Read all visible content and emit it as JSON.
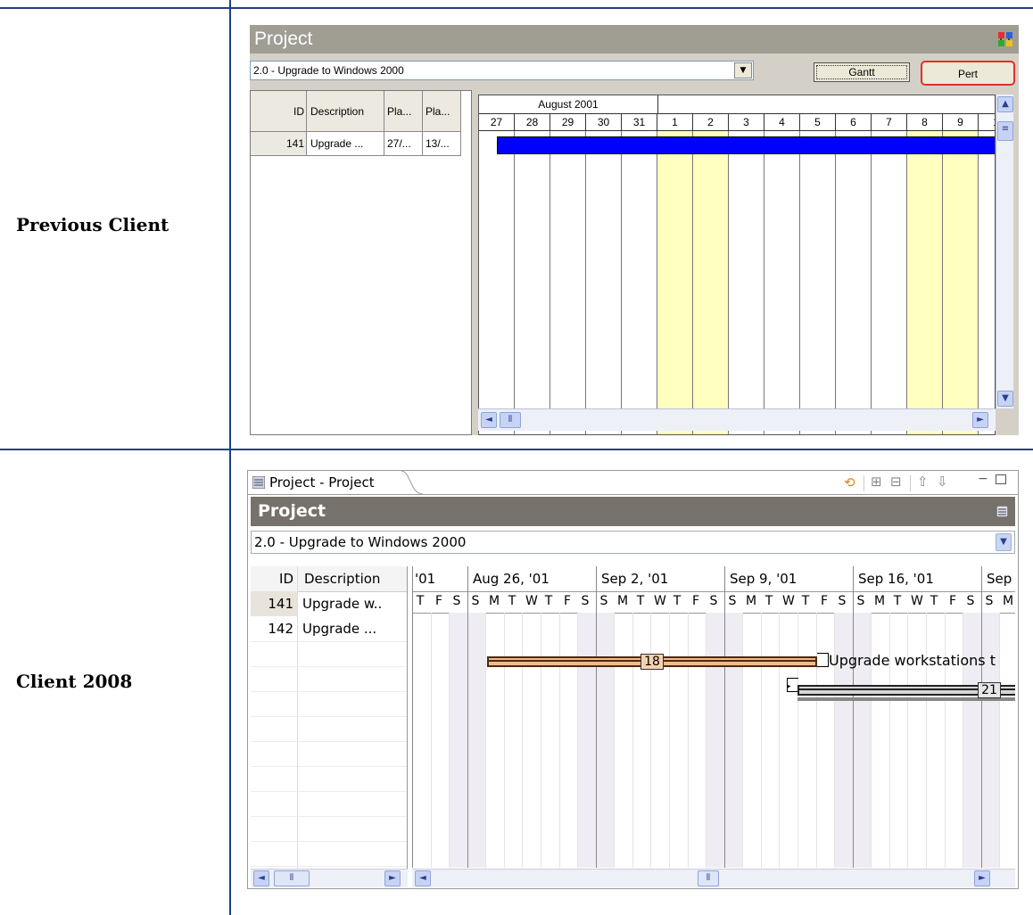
{
  "rows": {
    "previous_label": "Previous Client",
    "client2008_label": "Client 2008"
  },
  "panel1": {
    "title": "Project",
    "project_select": "2.0 - Upgrade to Windows 2000",
    "gantt_button": "Gantt",
    "pert_button": "Pert",
    "columns": [
      "ID",
      "Description",
      "Pla...",
      "Pla..."
    ],
    "row": [
      "141",
      "Upgrade ...",
      "27/...",
      "13/..."
    ],
    "month": "August 2001",
    "days": [
      "27",
      "28",
      "29",
      "30",
      "31",
      "1",
      "2",
      "3",
      "4",
      "5",
      "6",
      "7",
      "8",
      "9",
      "1"
    ],
    "highlight_color": "#ffffc0",
    "bar_color": "#0000ff"
  },
  "panel2": {
    "tab": "Project - Project",
    "title": "Project",
    "project_select": "2.0 - Upgrade to Windows 2000",
    "columns": [
      "ID",
      "Description"
    ],
    "rows": [
      {
        "id": "141",
        "desc": "Upgrade w.."
      },
      {
        "id": "142",
        "desc": "Upgrade ..."
      }
    ],
    "weeks": [
      "'01",
      "Aug 26, '01",
      "Sep 2, '01",
      "Sep 9, '01",
      "Sep 16, '01",
      "Sep"
    ],
    "day_letters": [
      "T",
      "F",
      "S",
      "S",
      "M",
      "T",
      "W",
      "T",
      "F",
      "S",
      "S",
      "M",
      "T",
      "W",
      "T",
      "F",
      "S",
      "S",
      "M",
      "T",
      "W",
      "T",
      "F",
      "S",
      "S",
      "M",
      "T",
      "W",
      "T",
      "F",
      "S",
      "S",
      "M"
    ],
    "task1_duration": "18",
    "task1_label": "Upgrade workstations t",
    "task2_duration": "21",
    "task1_color": "#f6b98a",
    "task2_color": "#d6d6d6"
  }
}
